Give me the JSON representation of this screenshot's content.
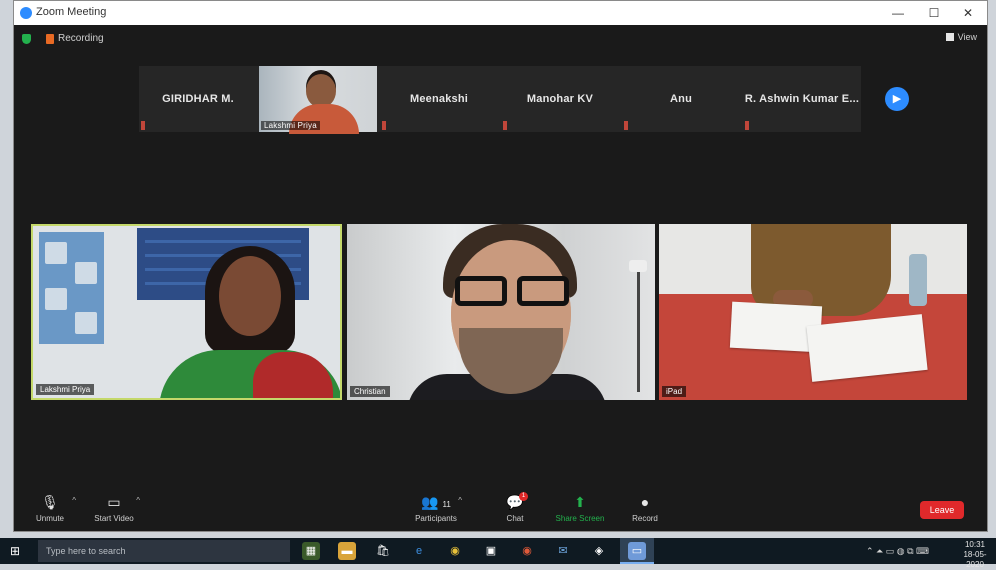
{
  "window": {
    "title": "Zoom Meeting",
    "controls": {
      "minimize": "—",
      "maximize": "☐",
      "close": "✕"
    }
  },
  "topbar": {
    "recording_label": "Recording",
    "view_label": "View"
  },
  "participants_strip": [
    {
      "name": "GIRIDHAR M."
    },
    {
      "name": "Lakshmi Priya",
      "video": true
    },
    {
      "name": "Meenakshi"
    },
    {
      "name": "Manohar KV"
    },
    {
      "name": "Anu"
    },
    {
      "name": "R. Ashwin Kumar E..."
    }
  ],
  "video_tiles": [
    {
      "name": "Lakshmi Priya"
    },
    {
      "name": "Christian"
    },
    {
      "name": "iPad"
    }
  ],
  "toolbar": {
    "mute": "Unmute",
    "video": "Start Video",
    "participants": "Participants",
    "participants_count": "11",
    "chat": "Chat",
    "chat_badge": "1",
    "share": "Share Screen",
    "record": "Record",
    "end": "Leave"
  },
  "taskbar": {
    "search_placeholder": "Type here to search",
    "time": "10:31",
    "date": "18-05-2020"
  },
  "colors": {
    "accent": "#2d8cff",
    "active_speaker": "#c4d86a",
    "share_green": "#23b14d",
    "end_red": "#e0292b"
  }
}
